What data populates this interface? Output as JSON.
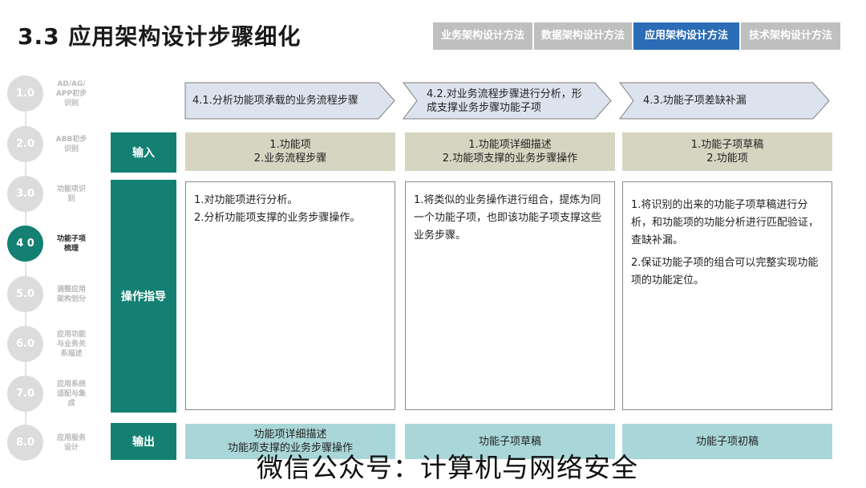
{
  "title": "3.3 应用架构设计步骤细化",
  "tabs": [
    {
      "label": "业务架构设计方法",
      "active": false
    },
    {
      "label": "数据架构设计方法",
      "active": false
    },
    {
      "label": "应用架构设计方法",
      "active": true
    },
    {
      "label": "技术架构设计方法",
      "active": false
    }
  ],
  "steps": [
    {
      "num": "1.0",
      "label": "AD/AG/ APP初步 识别",
      "active": false
    },
    {
      "num": "2.0",
      "label": "ABB初步 识别",
      "active": false
    },
    {
      "num": "3.0",
      "label": "功能项识 别",
      "active": false
    },
    {
      "num": "4 0",
      "label": "功能子项 梳理",
      "active": true
    },
    {
      "num": "5.0",
      "label": "调整应用 架构划分",
      "active": false
    },
    {
      "num": "6.0",
      "label": "应用功能 与业务关 系描述",
      "active": false
    },
    {
      "num": "7.0",
      "label": "应用系统 适配与集 成",
      "active": false
    },
    {
      "num": "8.0",
      "label": "应用服务 设计",
      "active": false
    }
  ],
  "columns": [
    {
      "header": "4.1.分析功能项承载的业务流程步骤"
    },
    {
      "header": "4.2.对业务流程步骤进行分析，形成支撑业务步骤功能子项"
    },
    {
      "header": "4.3.功能子项差缺补漏"
    }
  ],
  "rows": {
    "input": "输入",
    "operation": "操作指导",
    "output": "输出"
  },
  "inputs": [
    [
      "1.功能项",
      "2.业务流程步骤"
    ],
    [
      "1.功能项详细描述",
      "2.功能项支撑的业务步骤操作"
    ],
    [
      "1.功能子项草稿",
      "2.功能项"
    ]
  ],
  "operations": [
    [
      "1.对功能项进行分析。",
      "2.分析功能项支撑的业务步骤操作。"
    ],
    [
      "1.将类似的业务操作进行组合，提炼为同一个功能子项，也即该功能子项支撑这些业务步骤。"
    ],
    [
      "1.将识别的出来的功能子项草稿进行分析，和功能项的功能分析进行匹配验证，查缺补漏。",
      "2.保证功能子项的组合可以完整实现功能项的功能定位。"
    ]
  ],
  "outputs": [
    [
      "功能项详细描述",
      "功能项支撑的业务步骤操作"
    ],
    [
      "功能子项草稿"
    ],
    [
      "功能子项初稿"
    ]
  ],
  "watermark": "微信公众号：计算机与网络安全",
  "colors": {
    "teal": "#138073",
    "tab_active": "#2a6cb5",
    "tab_inactive": "#bfbfbf",
    "input_bg": "#d6d5c1",
    "output_bg": "#a9d6d8",
    "chevron_bg": "#dde3ee"
  }
}
